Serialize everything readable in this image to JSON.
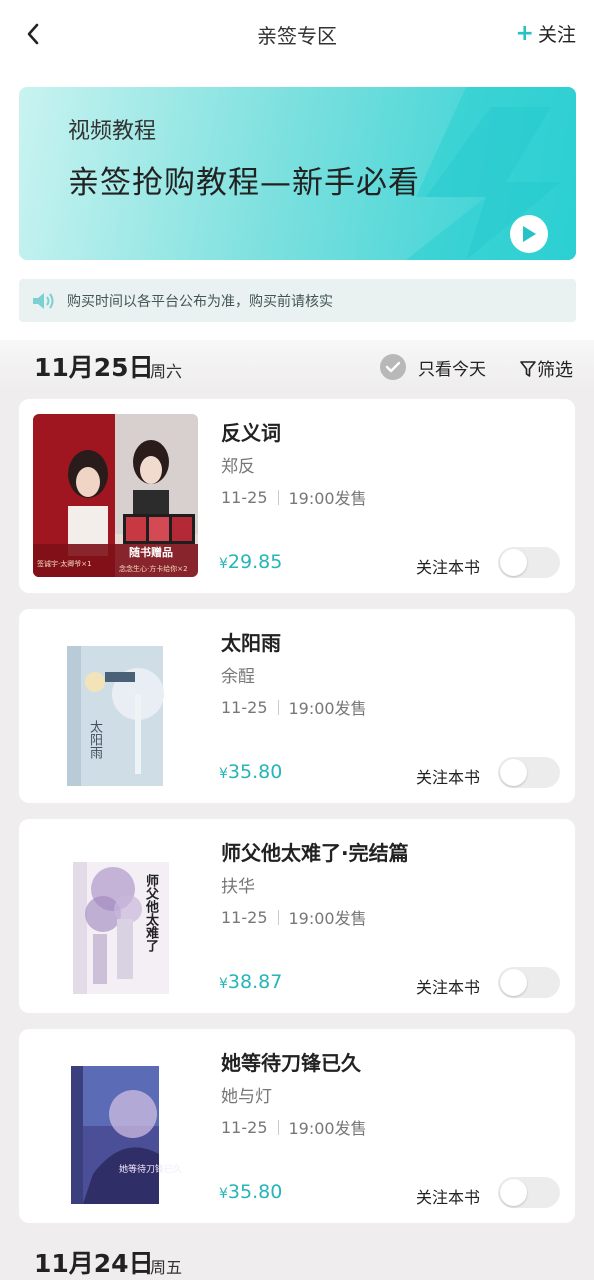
{
  "header": {
    "title": "亲签专区",
    "follow_plus": "+",
    "follow_label": "关注"
  },
  "banner": {
    "subtitle": "视频教程",
    "title": "亲签抢购教程—新手必看"
  },
  "notice": {
    "text": "购买时间以各平台公布为准，购买前请核实"
  },
  "dates": [
    {
      "date": "11月25日",
      "weekday": "周六"
    },
    {
      "date": "11月24日",
      "weekday": "周五"
    }
  ],
  "filters": {
    "today_only": "只看今天",
    "filter": "筛选"
  },
  "books": [
    {
      "title": "反义词",
      "author": "郑反",
      "date": "11-25",
      "time": "19:00发售",
      "currency": "¥",
      "price": "29.85",
      "follow": "关注本书",
      "cover_text": {
        "line1": "随书赠品",
        "line2": "签诚宇·太卿爷×1",
        "line3": "念念生心·方卡给你×2"
      }
    },
    {
      "title": "太阳雨",
      "author": "余酲",
      "date": "11-25",
      "time": "19:00发售",
      "currency": "¥",
      "price": "35.80",
      "follow": "关注本书",
      "cover_text": {
        "line1": "太阳雨"
      }
    },
    {
      "title": "师父他太难了·完结篇",
      "author": "扶华",
      "date": "11-25",
      "time": "19:00发售",
      "currency": "¥",
      "price": "38.87",
      "follow": "关注本书",
      "cover_text": {
        "line1": "师父他太难了"
      }
    },
    {
      "title": "她等待刀锋已久",
      "author": "她与灯",
      "date": "11-25",
      "time": "19:00发售",
      "currency": "¥",
      "price": "35.80",
      "follow": "关注本书",
      "cover_text": {
        "line1": "她等待刀锋已久"
      }
    }
  ],
  "colors": {
    "accent": "#26c2c6",
    "price": "#26b5b8",
    "background": "#efeded"
  }
}
